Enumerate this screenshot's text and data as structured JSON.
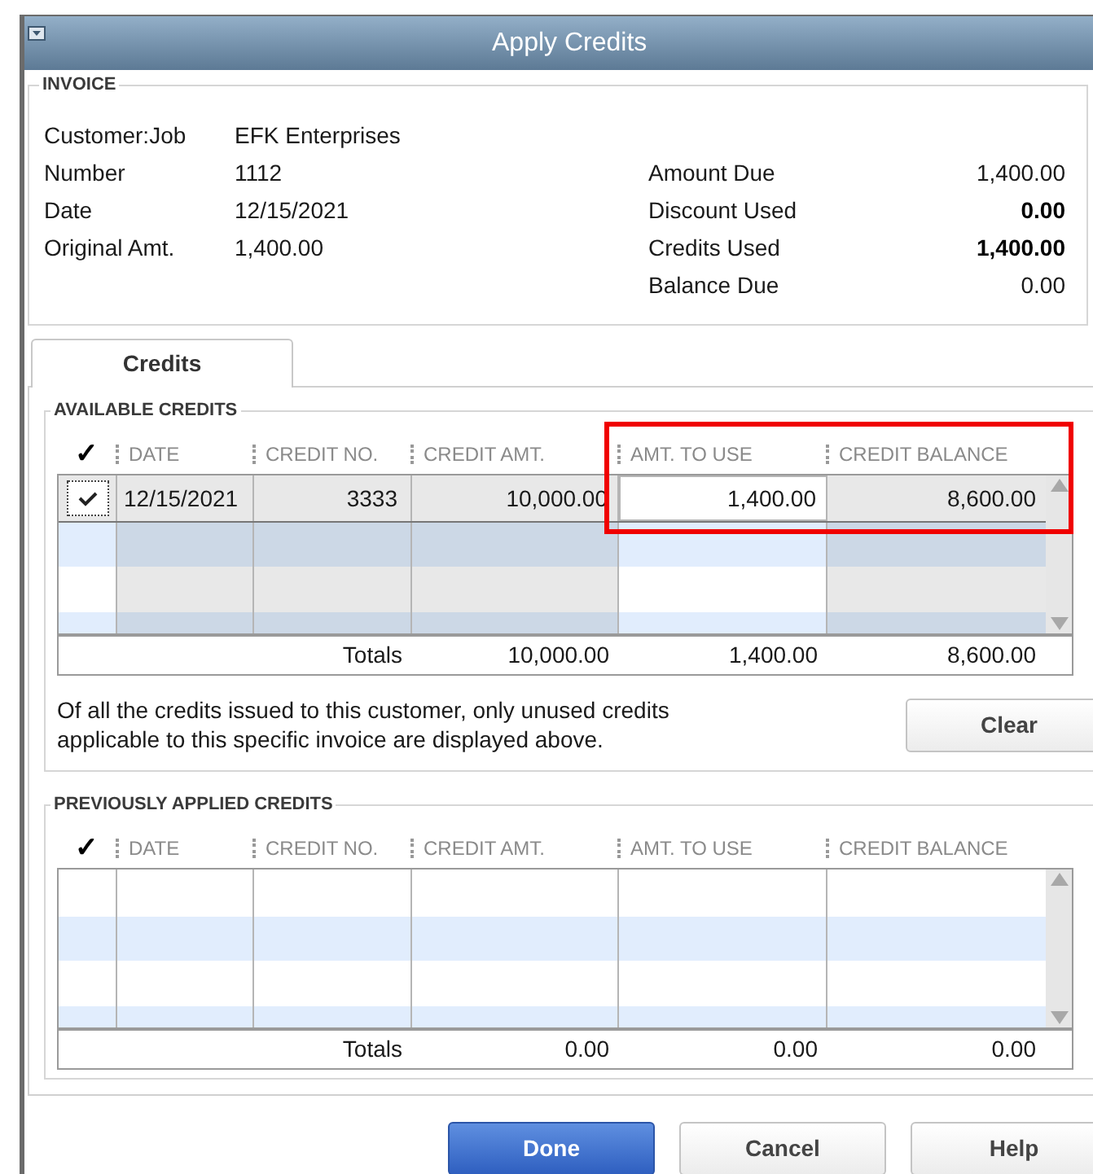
{
  "window": {
    "title": "Apply Credits"
  },
  "invoice": {
    "heading": "INVOICE",
    "fields": [
      {
        "label": "Customer:Job",
        "value": "EFK Enterprises"
      },
      {
        "label": "Number",
        "value": "1112"
      },
      {
        "label": "Date",
        "value": "12/15/2021"
      },
      {
        "label": "Original Amt.",
        "value": "1,400.00"
      }
    ],
    "summary": [
      {
        "label": "Amount Due",
        "value": "1,400.00",
        "bold": false
      },
      {
        "label": "Discount Used",
        "value": "0.00",
        "bold": true
      },
      {
        "label": "Credits Used",
        "value": "1,400.00",
        "bold": true
      },
      {
        "label": "Balance Due",
        "value": "0.00",
        "bold": false
      }
    ]
  },
  "tabs": [
    {
      "label": "Credits",
      "selected": true
    }
  ],
  "available_credits": {
    "heading": "AVAILABLE CREDITS",
    "columns": [
      "✓",
      "DATE",
      "CREDIT NO.",
      "CREDIT AMT.",
      "AMT. TO USE",
      "CREDIT BALANCE"
    ],
    "rows": [
      {
        "checked": true,
        "selected": true,
        "date": "12/15/2021",
        "credit_no": "3333",
        "credit_amt": "10,000.00",
        "amt_to_use": "1,400.00",
        "credit_balance": "8,600.00"
      }
    ],
    "totals": {
      "label": "Totals",
      "credit_amt": "10,000.00",
      "amt_to_use": "1,400.00",
      "credit_balance": "8,600.00"
    },
    "note": "Of all the credits issued to this customer, only unused credits applicable to this specific invoice are displayed above.",
    "clear_button": "Clear"
  },
  "previously_applied_credits": {
    "heading": "PREVIOUSLY APPLIED CREDITS",
    "columns": [
      "✓",
      "DATE",
      "CREDIT NO.",
      "CREDIT AMT.",
      "AMT. TO USE",
      "CREDIT BALANCE"
    ],
    "totals": {
      "label": "Totals",
      "credit_amt": "0.00",
      "amt_to_use": "0.00",
      "credit_balance": "0.00"
    }
  },
  "buttons": [
    {
      "label": "Done",
      "kind": "primary"
    },
    {
      "label": "Cancel",
      "kind": "normal"
    },
    {
      "label": "Help",
      "kind": "normal"
    }
  ]
}
